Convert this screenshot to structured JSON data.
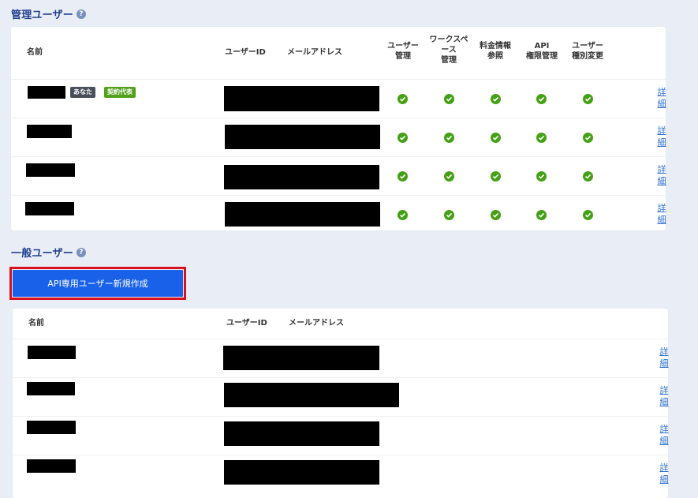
{
  "admin_section": {
    "title": "管理ユーザー",
    "help_icon": "?",
    "headers": {
      "name": "名前",
      "user_id": "ユーザーID",
      "email": "メールアドレス",
      "perm_user_mgmt_1": "ユーザー",
      "perm_user_mgmt_2": "管理",
      "perm_workspace_1": "ワークスペ",
      "perm_workspace_2": "ース",
      "perm_workspace_3": "管理",
      "perm_billing_1": "料金情報",
      "perm_billing_2": "参照",
      "perm_api_1": "API",
      "perm_api_2": "権限管理",
      "perm_type_1": "ユーザー",
      "perm_type_2": "種別変更"
    },
    "badges": {
      "you": "あなた",
      "contract_rep": "契約代表"
    },
    "badge_colors": {
      "you": "#4a4f5c",
      "contract_rep": "#52a11c"
    },
    "check_color": "#44a014",
    "detail_label_1": "詳",
    "detail_label_2": "細"
  },
  "general_section": {
    "title": "一般ユーザー",
    "help_icon": "?",
    "create_button": "API専用ユーザー新規作成",
    "headers": {
      "name": "名前",
      "user_id": "ユーザーID",
      "email": "メールアドレス"
    },
    "detail_label_1": "詳",
    "detail_label_2": "細"
  }
}
